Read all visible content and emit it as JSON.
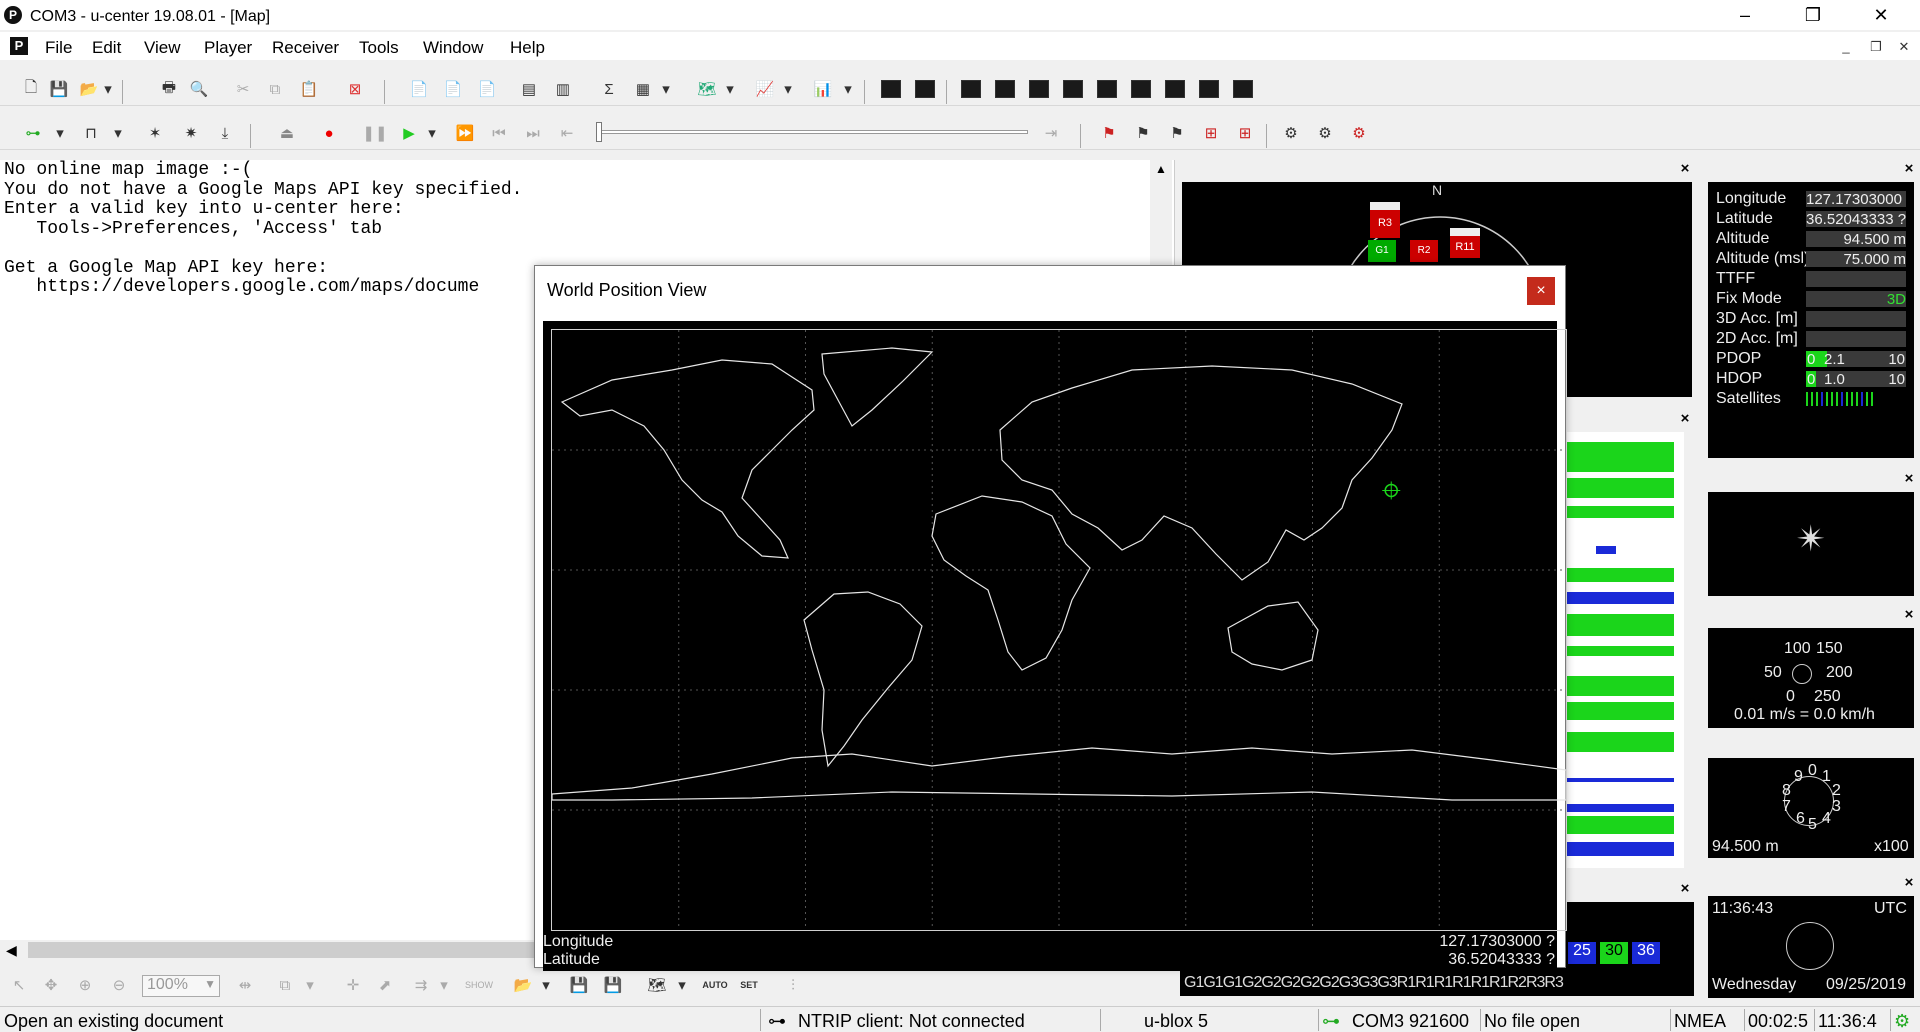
{
  "window": {
    "app_icon": "P",
    "title": "COM3 - u-center 19.08.01 - [Map]",
    "minimize": "–",
    "restore": "❐",
    "close": "✕"
  },
  "menu": {
    "doc_icon": "P",
    "items": [
      "File",
      "Edit",
      "View",
      "Player",
      "Receiver",
      "Tools",
      "Window",
      "Help"
    ],
    "mdi_min": "_",
    "mdi_restore": "❐",
    "mdi_close": "✕"
  },
  "map_text": {
    "lines": [
      "No online map image :-(",
      "You do not have a Google Maps API key specified.",
      "Enter a valid key into u-center here:",
      "   Tools->Preferences, 'Access' tab",
      "",
      "Get a Google Map API key here:",
      "   https://developers.google.com/maps/docume"
    ]
  },
  "world_dialog": {
    "title": "World Position View",
    "close": "×",
    "longitude_label": "Longitude",
    "latitude_label": "Latitude",
    "longitude_value": "127.17303000 ?",
    "latitude_value": "36.52043333 ?"
  },
  "bottom_toolbar": {
    "zoom": "100%",
    "auto_label": "AUTO",
    "set_label": "SET"
  },
  "data_panel": {
    "rows": [
      {
        "label": "Longitude",
        "value": "127.17303000 ?"
      },
      {
        "label": "Latitude",
        "value": "36.52043333 ?"
      },
      {
        "label": "Altitude",
        "value": "94.500 m"
      },
      {
        "label": "Altitude (msl)",
        "value": "75.000 m"
      },
      {
        "label": "TTFF",
        "value": ""
      },
      {
        "label": "Fix Mode",
        "value": "3D"
      },
      {
        "label": "3D Acc. [m]",
        "value": ""
      },
      {
        "label": "2D Acc. [m]",
        "value": ""
      }
    ],
    "pdop": {
      "label": "PDOP",
      "min": "0",
      "value": "2.1",
      "max": "10",
      "level": 0.21
    },
    "hdop": {
      "label": "HDOP",
      "min": "0",
      "value": "1.0",
      "max": "10",
      "level": 0.1
    },
    "satellites_label": "Satellites"
  },
  "sky": {
    "north": "N",
    "labels": [
      "R3",
      "R11",
      "G1",
      "R2"
    ]
  },
  "speed": {
    "scale_labels": [
      "100",
      "150",
      "50",
      "200",
      "0",
      "250"
    ],
    "reading": "0.01 m/s = 0.0 km/h"
  },
  "altimeter": {
    "digits": [
      "9",
      "0",
      "1",
      "8",
      "2",
      "7",
      "3",
      "6",
      "5",
      "4"
    ],
    "altitude": "94.500 m",
    "multiplier": "x100"
  },
  "clock": {
    "time": "11:36:43",
    "zone": "UTC",
    "weekday": "Wednesday",
    "date": "09/25/2019"
  },
  "sat_strip": {
    "labels": "G1G1G1G2G2G2G2G2G3G3G3R1R1R1R1R1R1R2R3R3",
    "values": [
      "25",
      "30",
      "36"
    ]
  },
  "status": {
    "hint": "Open an existing document",
    "ntrip": "NTRIP client: Not connected",
    "device": "u-blox 5",
    "port": "COM3 921600",
    "file": "No file open",
    "protocol": "NMEA",
    "elapsed": "00:02:5",
    "time": "11:36:4"
  },
  "colors": {
    "accent_close": "#c42b1c",
    "signal_green": "#1bd51b",
    "signal_blue": "#1a2ad8"
  }
}
